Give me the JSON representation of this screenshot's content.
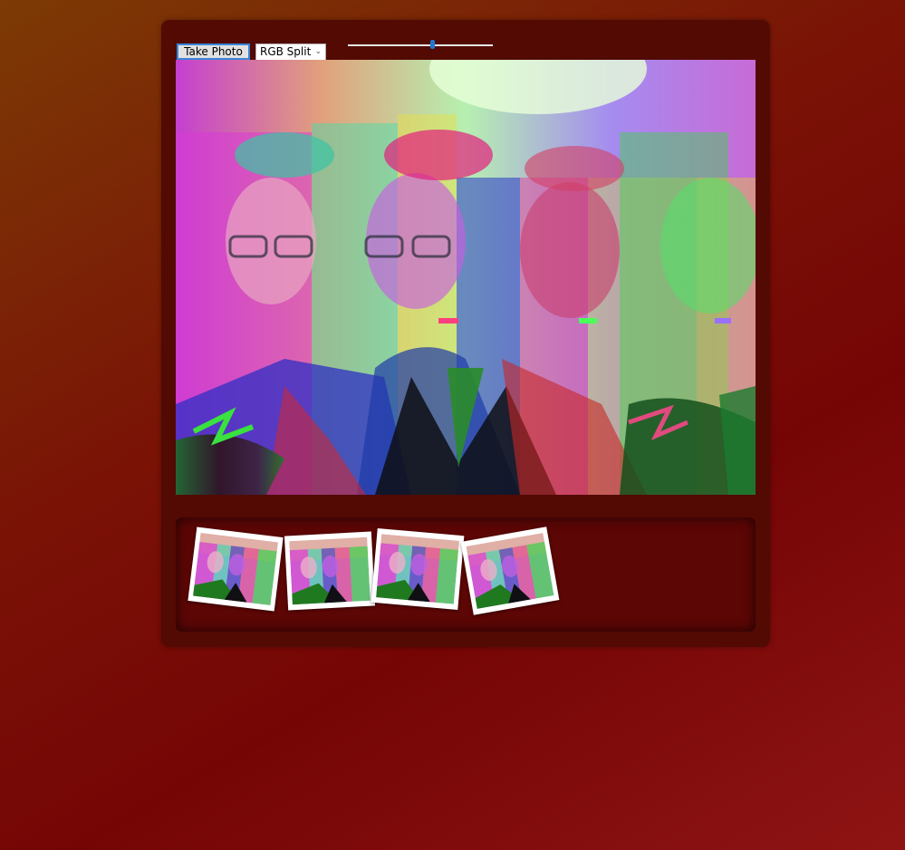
{
  "controls": {
    "take_photo_label": "Take Photo",
    "filter_selected": "RGB Split",
    "slider_level": 0.58
  },
  "camera": {
    "filter": "RGB Split"
  },
  "strip": {
    "photos": [
      {
        "rotation": 7
      },
      {
        "rotation": -3
      },
      {
        "rotation": 5
      },
      {
        "rotation": -10
      }
    ]
  }
}
